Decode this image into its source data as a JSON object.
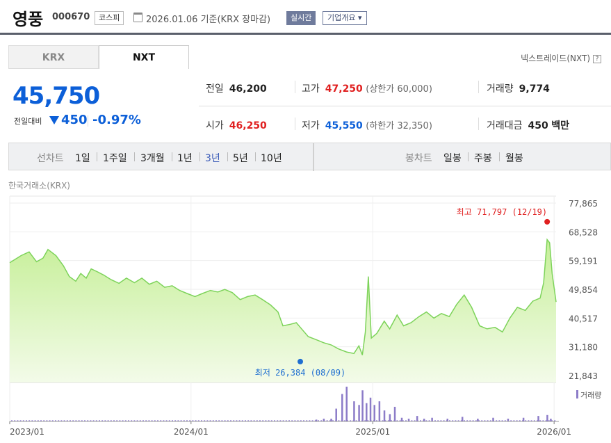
{
  "header": {
    "name": "영풍",
    "code": "000670",
    "market": "코스피",
    "date_text": "2026.01.06 기준(KRX 장마감)",
    "live_button": "실시간",
    "info_button": "기업개요 ▾"
  },
  "tabs": [
    "KRX",
    "NXT"
  ],
  "nex_link": "넥스트레이드(NXT)",
  "nex_help": "?",
  "quote": {
    "price": "45,750",
    "change_label": "전일대비",
    "change": "450",
    "change_pct": "-0.97%"
  },
  "stats": {
    "prev_label": "전일",
    "prev": "46,200",
    "high_label": "고가",
    "high": "47,250",
    "high_note": "(상한가 60,000)",
    "volume_label": "거래량",
    "volume": "9,774",
    "open_label": "시가",
    "open": "46,250",
    "low_label": "저가",
    "low": "45,550",
    "low_note": "(하한가 32,350)",
    "amount_label": "거래대금",
    "amount": "450",
    "amount_unit": "백만"
  },
  "period_bar": {
    "line_chart_label": "선차트",
    "periods": [
      "1일",
      "1주일",
      "3개월",
      "1년",
      "3년",
      "5년",
      "10년"
    ],
    "selected": "3년",
    "candle_label": "봉차트",
    "candles": [
      "일봉",
      "주봉",
      "월봉"
    ]
  },
  "source_label": "한국거래소(KRX)",
  "colors": {
    "accent": "#0c5fd8",
    "up": "#e02020",
    "line": "#7dd35a",
    "volume": "#8c7cc8"
  },
  "chart_data": {
    "type": "area",
    "ylim": [
      21843,
      77865
    ],
    "yticks": [
      77865,
      68528,
      59191,
      49854,
      40517,
      31180,
      21843
    ],
    "ytick_labels": [
      "77,865",
      "68,528",
      "59,191",
      "49,854",
      "40,517",
      "31,180",
      "21,843"
    ],
    "xtick_labels": [
      "2023/01",
      "2024/01",
      "2025/01",
      "2026/01"
    ],
    "x_start": "2023-01-02",
    "x_end": "2026-01-06",
    "xtick_dates": [
      "2023-01-02",
      "2024-01-02",
      "2025-01-02",
      "2026-01-02"
    ],
    "annotations": {
      "max_label": "최고 71,797 (12/19)",
      "max_value": 71797,
      "max_date": "2025-12-19",
      "min_label": "최저 26,384 (08/09)",
      "min_value": 26384,
      "min_date": "2024-08-09"
    },
    "volume_legend": "거래량",
    "series": [
      {
        "name": "종가",
        "points": [
          [
            "2023-01-02",
            58500
          ],
          [
            "2023-01-25",
            60800
          ],
          [
            "2023-02-10",
            62000
          ],
          [
            "2023-02-25",
            58800
          ],
          [
            "2023-03-10",
            60000
          ],
          [
            "2023-03-20",
            62800
          ],
          [
            "2023-04-05",
            60800
          ],
          [
            "2023-04-20",
            57500
          ],
          [
            "2023-05-02",
            54000
          ],
          [
            "2023-05-15",
            52500
          ],
          [
            "2023-05-25",
            55000
          ],
          [
            "2023-06-05",
            53500
          ],
          [
            "2023-06-15",
            56500
          ],
          [
            "2023-06-28",
            55500
          ],
          [
            "2023-07-10",
            54500
          ],
          [
            "2023-07-25",
            53000
          ],
          [
            "2023-08-10",
            51800
          ],
          [
            "2023-08-25",
            53500
          ],
          [
            "2023-09-10",
            52000
          ],
          [
            "2023-09-25",
            53500
          ],
          [
            "2023-10-10",
            51500
          ],
          [
            "2023-10-25",
            52500
          ],
          [
            "2023-11-10",
            50500
          ],
          [
            "2023-11-25",
            51000
          ],
          [
            "2023-12-10",
            49500
          ],
          [
            "2023-12-25",
            48500
          ],
          [
            "2024-01-10",
            47500
          ],
          [
            "2024-01-25",
            48500
          ],
          [
            "2024-02-10",
            49500
          ],
          [
            "2024-02-25",
            49000
          ],
          [
            "2024-03-10",
            49800
          ],
          [
            "2024-03-25",
            48800
          ],
          [
            "2024-04-10",
            46500
          ],
          [
            "2024-04-25",
            47500
          ],
          [
            "2024-05-10",
            48000
          ],
          [
            "2024-05-25",
            46500
          ],
          [
            "2024-06-10",
            44800
          ],
          [
            "2024-06-25",
            42500
          ],
          [
            "2024-07-05",
            38000
          ],
          [
            "2024-07-20",
            38500
          ],
          [
            "2024-08-01",
            39000
          ],
          [
            "2024-08-09",
            37500
          ],
          [
            "2024-08-25",
            34500
          ],
          [
            "2024-09-10",
            33500
          ],
          [
            "2024-09-25",
            32500
          ],
          [
            "2024-10-10",
            31800
          ],
          [
            "2024-10-25",
            30500
          ],
          [
            "2024-11-10",
            29500
          ],
          [
            "2024-11-25",
            29000
          ],
          [
            "2024-12-05",
            31500
          ],
          [
            "2024-12-12",
            28500
          ],
          [
            "2024-12-18",
            36000
          ],
          [
            "2024-12-24",
            54000
          ],
          [
            "2024-12-30",
            34000
          ],
          [
            "2025-01-10",
            35500
          ],
          [
            "2025-01-25",
            39500
          ],
          [
            "2025-02-05",
            37000
          ],
          [
            "2025-02-20",
            41500
          ],
          [
            "2025-03-05",
            38000
          ],
          [
            "2025-03-20",
            39000
          ],
          [
            "2025-04-05",
            41000
          ],
          [
            "2025-04-20",
            42500
          ],
          [
            "2025-05-05",
            40500
          ],
          [
            "2025-05-20",
            42000
          ],
          [
            "2025-06-05",
            41000
          ],
          [
            "2025-06-20",
            45000
          ],
          [
            "2025-07-05",
            48000
          ],
          [
            "2025-07-20",
            44000
          ],
          [
            "2025-08-05",
            38000
          ],
          [
            "2025-08-20",
            37000
          ],
          [
            "2025-09-05",
            37500
          ],
          [
            "2025-09-20",
            36000
          ],
          [
            "2025-10-05",
            40500
          ],
          [
            "2025-10-20",
            44000
          ],
          [
            "2025-11-05",
            43000
          ],
          [
            "2025-11-20",
            46000
          ],
          [
            "2025-12-05",
            47000
          ],
          [
            "2025-12-12",
            52000
          ],
          [
            "2025-12-19",
            66000
          ],
          [
            "2025-12-24",
            65000
          ],
          [
            "2025-12-29",
            55000
          ],
          [
            "2026-01-06",
            45750
          ]
        ]
      }
    ],
    "volume_x_dates": [
      "2024-09-10",
      "2024-09-25",
      "2024-10-10",
      "2024-10-20",
      "2024-11-01",
      "2024-11-10",
      "2024-11-25",
      "2024-12-05",
      "2024-12-12",
      "2024-12-20",
      "2024-12-28",
      "2025-01-05",
      "2025-01-15",
      "2025-01-25",
      "2025-02-05",
      "2025-02-15",
      "2025-03-01",
      "2025-03-15",
      "2025-04-01",
      "2025-04-15",
      "2025-05-01",
      "2025-06-01",
      "2025-07-01",
      "2025-08-01",
      "2025-09-01",
      "2025-10-01",
      "2025-11-01",
      "2025-12-01",
      "2025-12-19",
      "2025-12-26"
    ],
    "volume_values": [
      2,
      3,
      3,
      14,
      30,
      38,
      22,
      18,
      34,
      20,
      26,
      18,
      22,
      12,
      8,
      16,
      4,
      3,
      6,
      3,
      4,
      3,
      5,
      3,
      4,
      3,
      4,
      6,
      7,
      3
    ]
  }
}
